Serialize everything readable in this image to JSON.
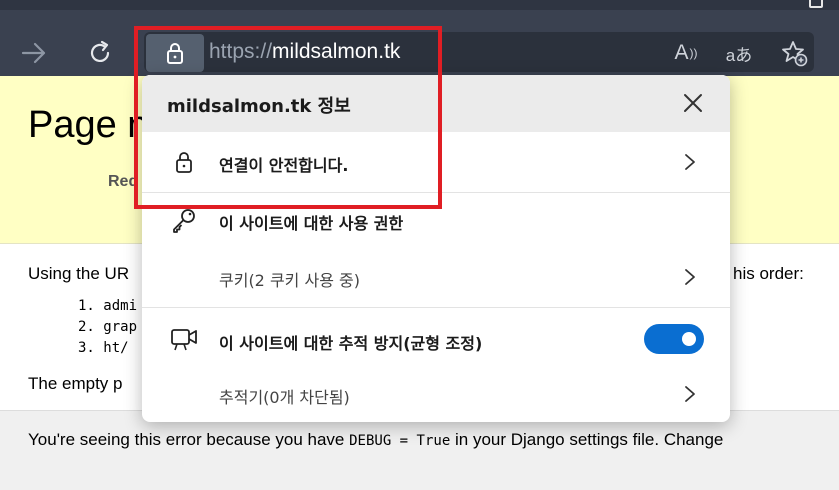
{
  "browser": {
    "url_prefix": "https://",
    "url_domain": "mildsalmon.tk",
    "read_aloud_label": "A",
    "translate_label": "aあ",
    "colors": {
      "toolbar": "#3a4150",
      "address_bar": "#2b313c"
    }
  },
  "page": {
    "title": "Page n",
    "request_label": "Req",
    "intro": "Using the UR",
    "intro_tail": "his order:",
    "patterns": [
      "1. admi",
      "2. grap",
      "3. ht/"
    ],
    "empty_text": "The empty p",
    "footer_pre": "You're seeing this error because you have ",
    "footer_code": "DEBUG = True",
    "footer_post": " in your Django settings file. Change"
  },
  "popup": {
    "title": "mildsalmon.tk 정보",
    "connection": "연결이 안전합니다.",
    "permissions": "이 사이트에 대한 사용 권한",
    "cookies": "쿠키(2 쿠키 사용 중)",
    "tracking": "이 사이트에 대한 추적 방지(균형 조정)",
    "trackers": "추적기(0개 차단됨)",
    "tracking_enabled": true,
    "colors": {
      "toggle": "#0a6ed1",
      "highlight": "#e01e24"
    }
  }
}
